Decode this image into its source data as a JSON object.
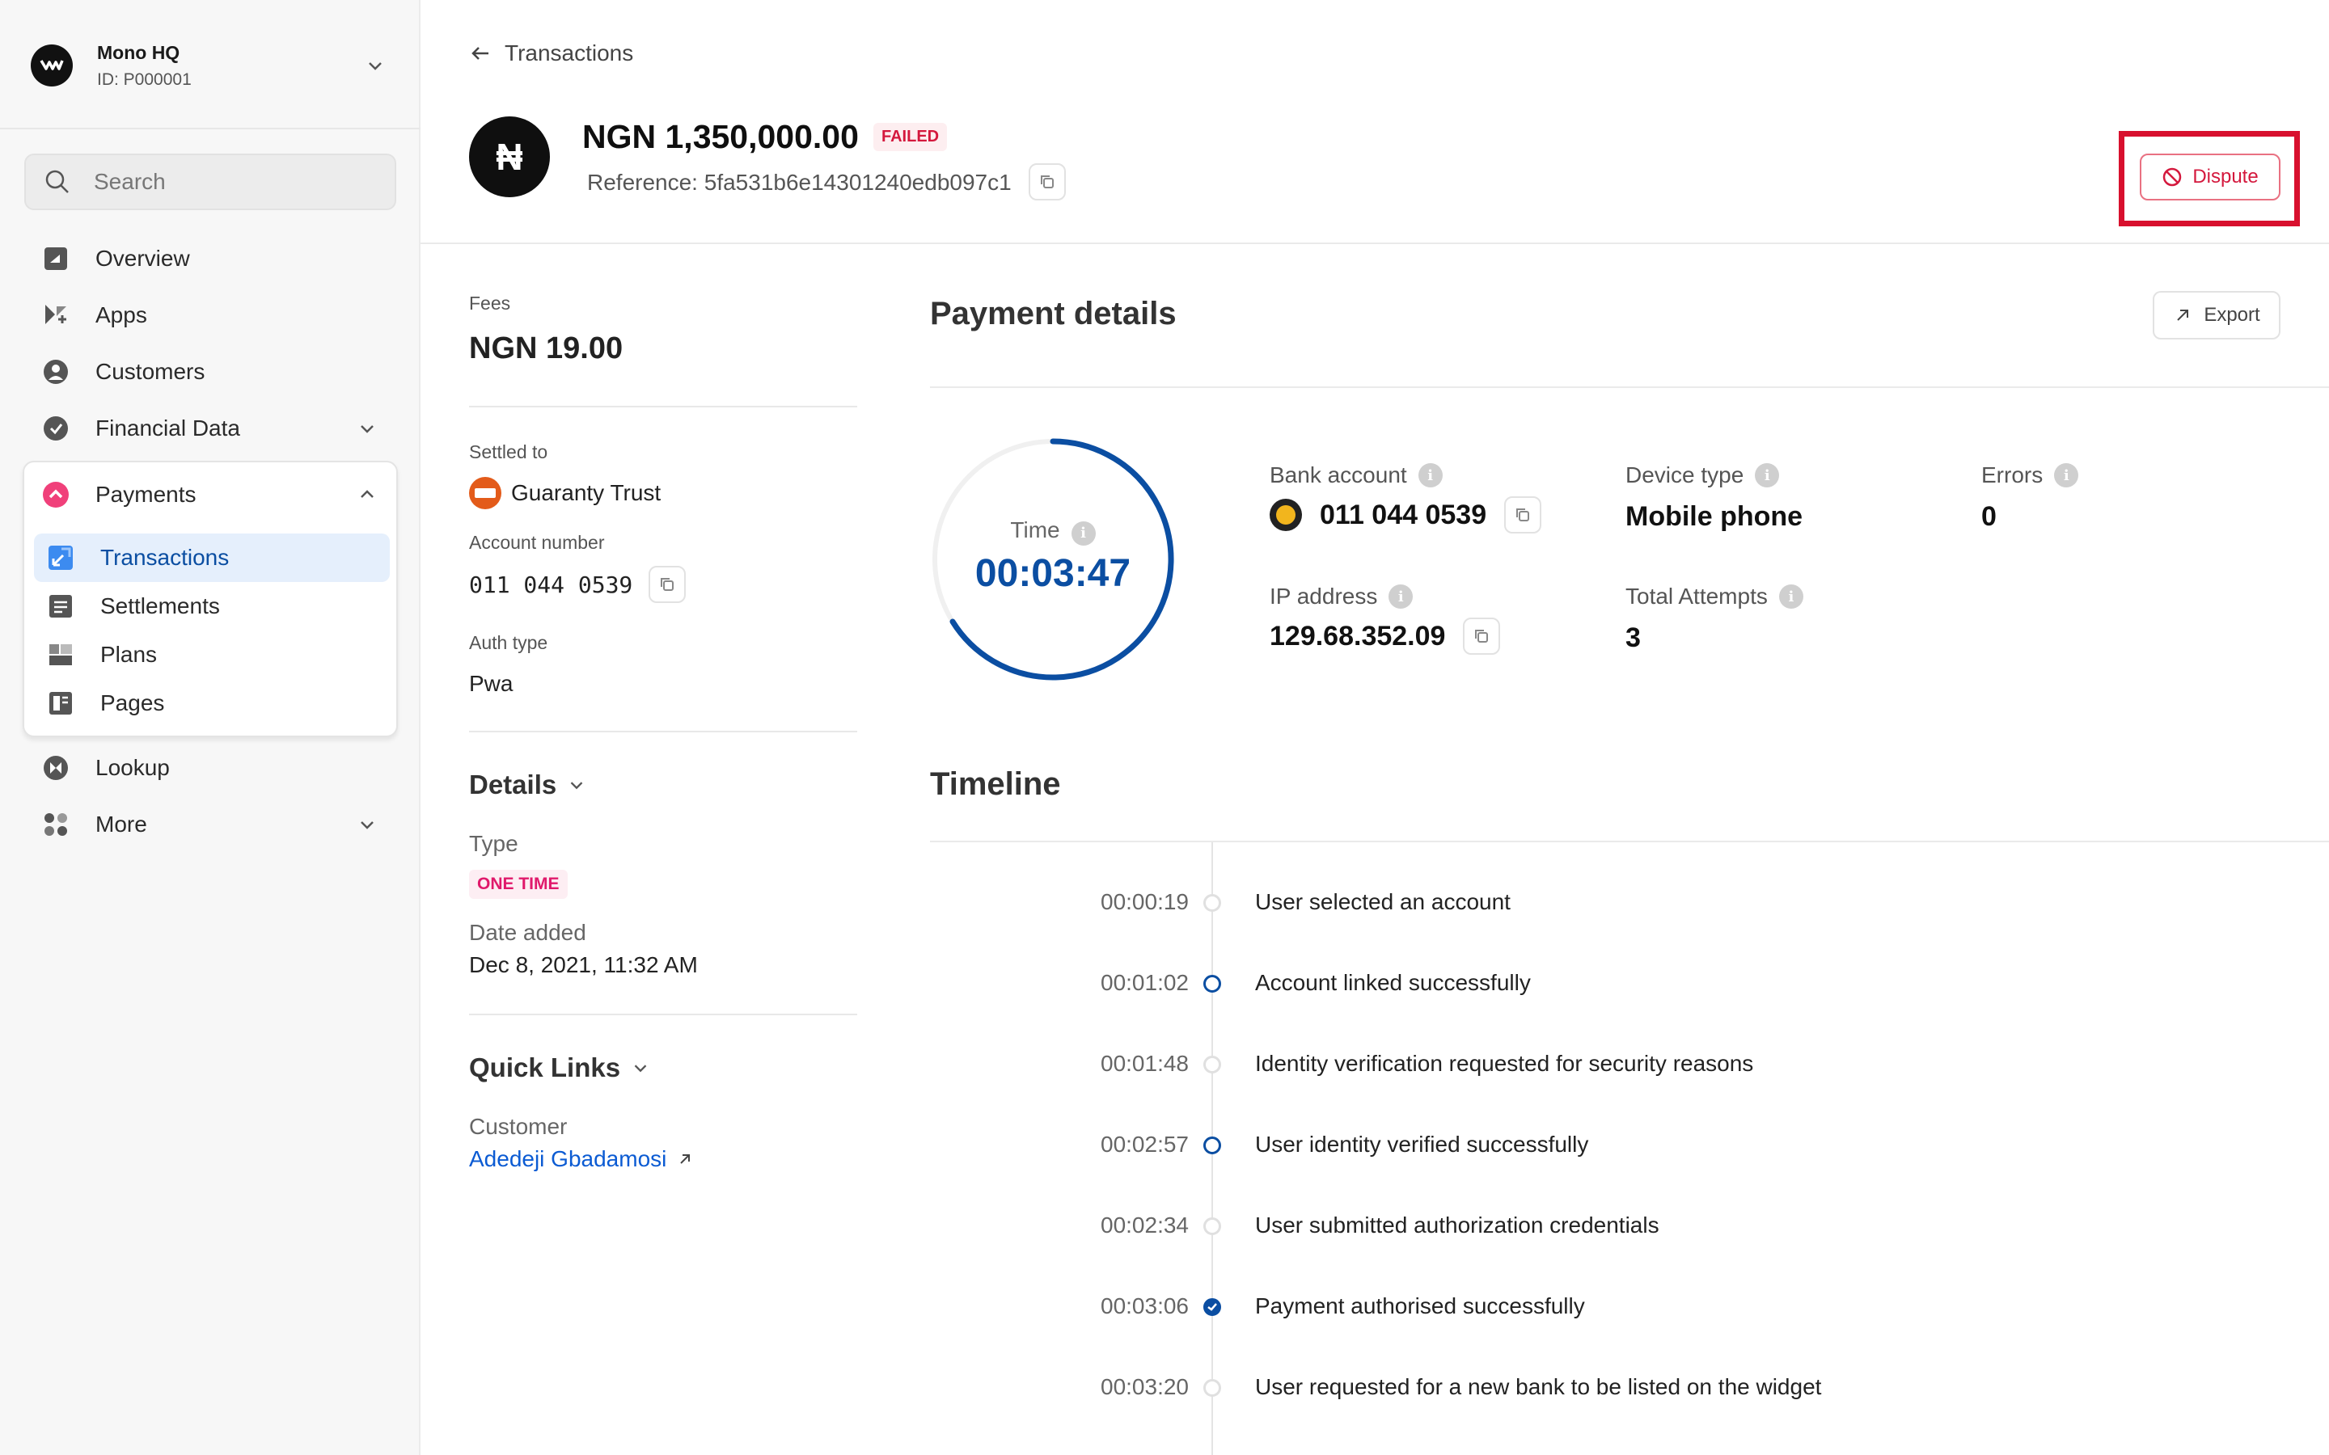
{
  "org": {
    "name": "Mono HQ",
    "id": "ID: P000001"
  },
  "sidebar": {
    "search_placeholder": "Search",
    "items": {
      "overview": "Overview",
      "apps": "Apps",
      "customers": "Customers",
      "financial_data": "Financial Data",
      "payments": "Payments",
      "lookup": "Lookup",
      "more": "More"
    },
    "payments_sub": {
      "transactions": "Transactions",
      "settlements": "Settlements",
      "plans": "Plans",
      "pages": "Pages"
    }
  },
  "header": {
    "back_label": "Transactions",
    "currency_symbol": "₦",
    "amount": "NGN 1,350,000.00",
    "status": "FAILED",
    "reference": "Reference: 5fa531b6e14301240edb097c1",
    "dispute_label": "Dispute"
  },
  "left": {
    "fees_label": "Fees",
    "fees_value": "NGN 19.00",
    "settled_label": "Settled to",
    "settled_bank": "Guaranty Trust",
    "account_label": "Account number",
    "account_value": "011 044 0539",
    "auth_label": "Auth type",
    "auth_value": "Pwa",
    "details_title": "Details",
    "type_label": "Type",
    "type_value": "ONE TIME",
    "date_label": "Date added",
    "date_value": "Dec 8, 2021, 11:32 AM",
    "quick_title": "Quick Links",
    "customer_label": "Customer",
    "customer_value": "Adedeji Gbadamosi"
  },
  "payment_details": {
    "title": "Payment details",
    "export_label": "Export",
    "time_label": "Time",
    "time_value": "00:03:47",
    "bank_label": "Bank account",
    "bank_value": "011 044 0539",
    "device_label": "Device type",
    "device_value": "Mobile phone",
    "errors_label": "Errors",
    "errors_value": "0",
    "ip_label": "IP address",
    "ip_value": "129.68.352.09",
    "attempts_label": "Total Attempts",
    "attempts_value": "3"
  },
  "timeline": {
    "title": "Timeline",
    "events": [
      {
        "time": "00:00:19",
        "text": "User selected an account"
      },
      {
        "time": "00:01:02",
        "text": "Account linked successfully"
      },
      {
        "time": "00:01:48",
        "text": "Identity verification requested for security reasons"
      },
      {
        "time": "00:02:57",
        "text": "User identity verified successfully"
      },
      {
        "time": "00:02:34",
        "text": "User submitted authorization credentials"
      },
      {
        "time": "00:03:06",
        "text": "Payment authorised successfully"
      },
      {
        "time": "00:03:20",
        "text": "User requested for a new bank to be listed on the widget"
      }
    ]
  },
  "colors": {
    "accent": "#0b4ea2",
    "danger": "#d4183d",
    "highlight": "#d8102e"
  }
}
